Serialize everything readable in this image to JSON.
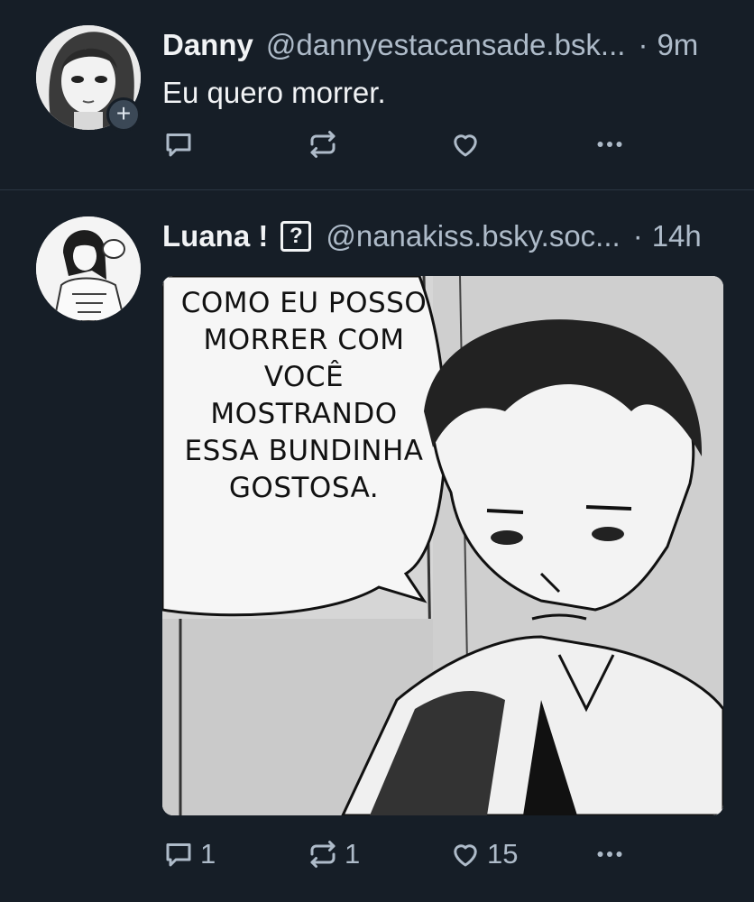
{
  "posts": [
    {
      "display_name": "Danny",
      "handle": "@dannyestacansade.bsk...",
      "time": "9m",
      "text": "Eu quero morrer.",
      "follow_badge": "+",
      "actions": {
        "reply": "",
        "repost": "",
        "like": ""
      }
    },
    {
      "display_name": "Luana !",
      "name_badge": "?",
      "handle": "@nanakiss.bsky.soc...",
      "time": "14h",
      "image_text": "COMO EU POSSO MORRER COM VOCÊ MOSTRANDO ESSA BUNDINHA GOSTOSA.",
      "actions": {
        "reply": "1",
        "repost": "1",
        "like": "15"
      }
    }
  ],
  "separator": "·",
  "colors": {
    "background": "#161e27",
    "muted": "#aebbc9",
    "text": "#f1f3f5",
    "divider": "#2b3642"
  },
  "icons": [
    "reply-icon",
    "repost-icon",
    "like-icon",
    "more-icon"
  ]
}
